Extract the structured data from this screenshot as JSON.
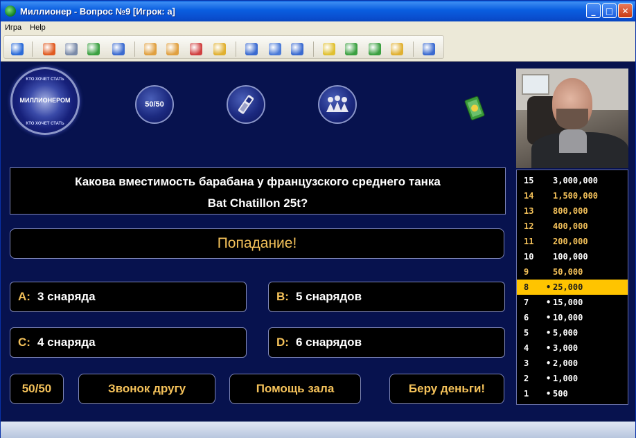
{
  "window": {
    "title": "Миллионер - Вопрос №9 [Игрок: а]",
    "controls": {
      "minimize": "_",
      "maximize": "□",
      "close": "✕"
    }
  },
  "menu": [
    "Игра",
    "Help"
  ],
  "toolbar_icons": [
    {
      "name": "refresh-icon",
      "color": "#2a6ad8"
    },
    {
      "name": "winamp-icon",
      "color": "#e05a20"
    },
    {
      "name": "cd-icon",
      "color": "#7a8aa8"
    },
    {
      "name": "globe-icon",
      "color": "#3aa040"
    },
    {
      "name": "timer-icon",
      "color": "#3a6ad0"
    },
    {
      "name": "user-icon",
      "color": "#e0a040"
    },
    {
      "name": "users-icon",
      "color": "#e0a040"
    },
    {
      "name": "notepad-icon",
      "color": "#d04040"
    },
    {
      "name": "hand-icon",
      "color": "#e0b030"
    },
    {
      "name": "table-icon",
      "color": "#3a6ad0"
    },
    {
      "name": "window-icon",
      "color": "#4a7ad8"
    },
    {
      "name": "search-icon",
      "color": "#3a6ad0"
    },
    {
      "name": "help-icon",
      "color": "#e0c030"
    },
    {
      "name": "info-icon",
      "color": "#3aa040"
    },
    {
      "name": "home-icon",
      "color": "#3aa040"
    },
    {
      "name": "mail-icon",
      "color": "#e0b030"
    },
    {
      "name": "exit-icon",
      "color": "#3a6ad0"
    }
  ],
  "logo": {
    "main": "МИЛЛИОНЕРОМ",
    "top": "КТО ХОЧЕТ СТАТЬ",
    "bottom": "КТО ХОЧЕТ СТАТЬ"
  },
  "lifelines": {
    "fifty": "50/50"
  },
  "question": {
    "line1": "Какова вместимость барабана у французского среднего танка",
    "line2": "Bat Chatillon 25t?"
  },
  "result": "Попадание!",
  "answers": [
    {
      "letter": "A:",
      "text": "3 снаряда"
    },
    {
      "letter": "B:",
      "text": "5 снарядов"
    },
    {
      "letter": "C:",
      "text": "4 снаряда"
    },
    {
      "letter": "D:",
      "text": "6 снарядов"
    }
  ],
  "action_buttons": {
    "fifty": "50/50",
    "call": "Звонок другу",
    "audience": "Помощь зала",
    "take_money": "Беру деньги!"
  },
  "ladder": [
    {
      "num": "15",
      "amount": "3,000,000",
      "dot": ""
    },
    {
      "num": "14",
      "amount": "1,500,000",
      "dot": ""
    },
    {
      "num": "13",
      "amount": "800,000",
      "dot": ""
    },
    {
      "num": "12",
      "amount": "400,000",
      "dot": ""
    },
    {
      "num": "11",
      "amount": "200,000",
      "dot": ""
    },
    {
      "num": "10",
      "amount": "100,000",
      "dot": ""
    },
    {
      "num": "9",
      "amount": "50,000",
      "dot": ""
    },
    {
      "num": "8",
      "amount": "25,000",
      "dot": "•"
    },
    {
      "num": "7",
      "amount": "15,000",
      "dot": "•"
    },
    {
      "num": "6",
      "amount": "10,000",
      "dot": "•"
    },
    {
      "num": "5",
      "amount": "5,000",
      "dot": "•"
    },
    {
      "num": "4",
      "amount": "3,000",
      "dot": "•"
    },
    {
      "num": "3",
      "amount": "2,000",
      "dot": "•"
    },
    {
      "num": "2",
      "amount": "1,000",
      "dot": "•"
    },
    {
      "num": "1",
      "amount": "500",
      "dot": "•"
    }
  ],
  "current_step": "8"
}
